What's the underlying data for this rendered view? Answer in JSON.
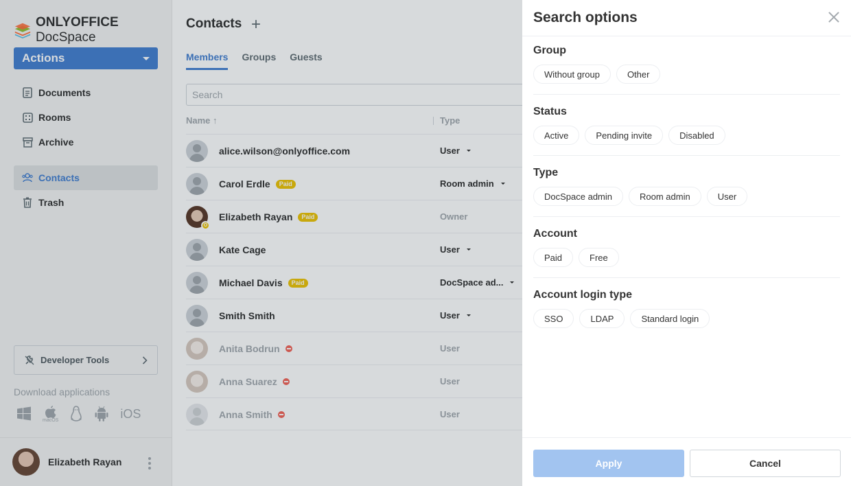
{
  "app": {
    "logo_bold": "ONLYOFFICE",
    "logo_rest": " DocSpace"
  },
  "sidebar": {
    "actions_label": "Actions",
    "items": [
      {
        "label": "Documents",
        "icon": "document-icon"
      },
      {
        "label": "Rooms",
        "icon": "rooms-icon"
      },
      {
        "label": "Archive",
        "icon": "archive-icon"
      },
      {
        "label": "Contacts",
        "icon": "contacts-icon",
        "active": true
      },
      {
        "label": "Trash",
        "icon": "trash-icon"
      }
    ],
    "developer_tools": "Developer Tools",
    "download_label": "Download applications",
    "download_platforms": [
      "windows",
      "macOS",
      "linux",
      "android",
      "iOS"
    ],
    "macos_caption": "macOS",
    "ios_label": "iOS",
    "profile_name": "Elizabeth Rayan"
  },
  "main": {
    "title": "Contacts",
    "tabs": [
      {
        "label": "Members",
        "active": true
      },
      {
        "label": "Groups"
      },
      {
        "label": "Guests"
      }
    ],
    "search_placeholder": "Search",
    "columns": {
      "name": "Name ↑",
      "type": "Type"
    },
    "rows": [
      {
        "name": "alice.wilson@onlyoffice.com",
        "type": "User"
      },
      {
        "name": "Carol Erdle",
        "paid": "Paid",
        "type": "Room admin"
      },
      {
        "name": "Elizabeth Rayan",
        "paid": "Paid",
        "type": "Owner",
        "owner_badge": "O"
      },
      {
        "name": "Kate Cage",
        "type": "User"
      },
      {
        "name": "Michael Davis",
        "paid": "Paid",
        "type": "DocSpace ad..."
      },
      {
        "name": "Smith Smith",
        "type": "User"
      },
      {
        "name": "Anita Bodrun",
        "type": "User",
        "disabled": true
      },
      {
        "name": "Anna Suarez",
        "type": "User",
        "disabled": true
      },
      {
        "name": "Anna Smith",
        "type": "User",
        "disabled": true
      }
    ]
  },
  "panel": {
    "title": "Search options",
    "sections": [
      {
        "title": "Group",
        "options": [
          "Without group",
          "Other"
        ]
      },
      {
        "title": "Status",
        "options": [
          "Active",
          "Pending invite",
          "Disabled"
        ]
      },
      {
        "title": "Type",
        "options": [
          "DocSpace admin",
          "Room admin",
          "User"
        ]
      },
      {
        "title": "Account",
        "options": [
          "Paid",
          "Free"
        ]
      },
      {
        "title": "Account login type",
        "options": [
          "SSO",
          "LDAP",
          "Standard login"
        ]
      }
    ],
    "apply_label": "Apply",
    "cancel_label": "Cancel"
  },
  "colors": {
    "accent": "#4781d1",
    "paid": "#edc409",
    "blocked": "#f2665a",
    "apply_disabled": "#a2c4f0"
  }
}
